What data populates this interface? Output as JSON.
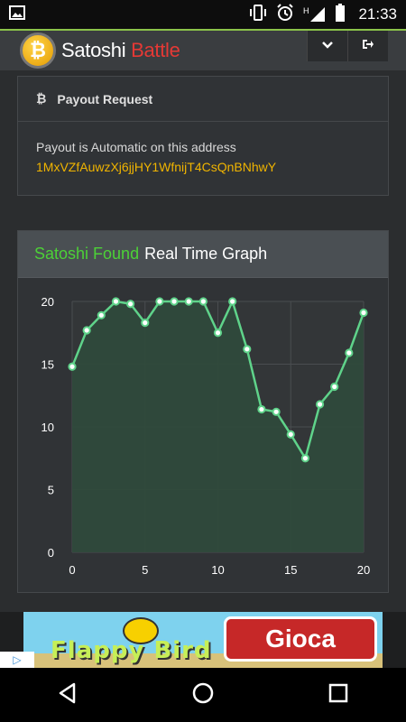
{
  "status_bar": {
    "time": "21:33",
    "network_label": "H",
    "icons": [
      "image-icon",
      "vibrate-icon",
      "alarm-icon",
      "signal-icon",
      "battery-icon"
    ]
  },
  "header": {
    "brand_part1": "Satoshi",
    "brand_part2": "Battle",
    "logo_symbol": "₿",
    "buttons": [
      "chevron-down-icon",
      "logout-icon"
    ]
  },
  "payout": {
    "title": "Payout Request",
    "icon": "bitcoin-icon",
    "text": "Payout is Automatic on this address",
    "address": "1MxVZfAuwzXj6jjHY1WfnijT4CsQnBNhwY"
  },
  "graph": {
    "title_green": "Satoshi Found",
    "title_white": "Real Time Graph"
  },
  "chart_data": {
    "type": "area",
    "x": [
      0,
      1,
      2,
      3,
      4,
      5,
      6,
      7,
      8,
      9,
      10,
      11,
      12,
      13,
      14,
      15,
      16,
      17,
      18,
      19,
      20
    ],
    "values": [
      14.8,
      17.7,
      18.9,
      20.0,
      19.8,
      18.3,
      20.0,
      20.0,
      20.0,
      20.0,
      17.5,
      20.0,
      16.2,
      11.4,
      11.2,
      9.4,
      7.5,
      11.8,
      13.2,
      15.9,
      19.1
    ],
    "xlim": [
      0,
      20
    ],
    "ylim": [
      0,
      20
    ],
    "x_ticks": [
      0,
      5,
      10,
      15,
      20
    ],
    "y_ticks": [
      0,
      5,
      10,
      15,
      20
    ],
    "grid": true,
    "line_color": "#5fd38a",
    "fill_color": "#2f4a3b"
  },
  "ad": {
    "game_title": "Flappy Bird",
    "cta": "Gioca",
    "badge": "▷"
  },
  "nav": [
    "back-icon",
    "home-icon",
    "recents-icon"
  ]
}
